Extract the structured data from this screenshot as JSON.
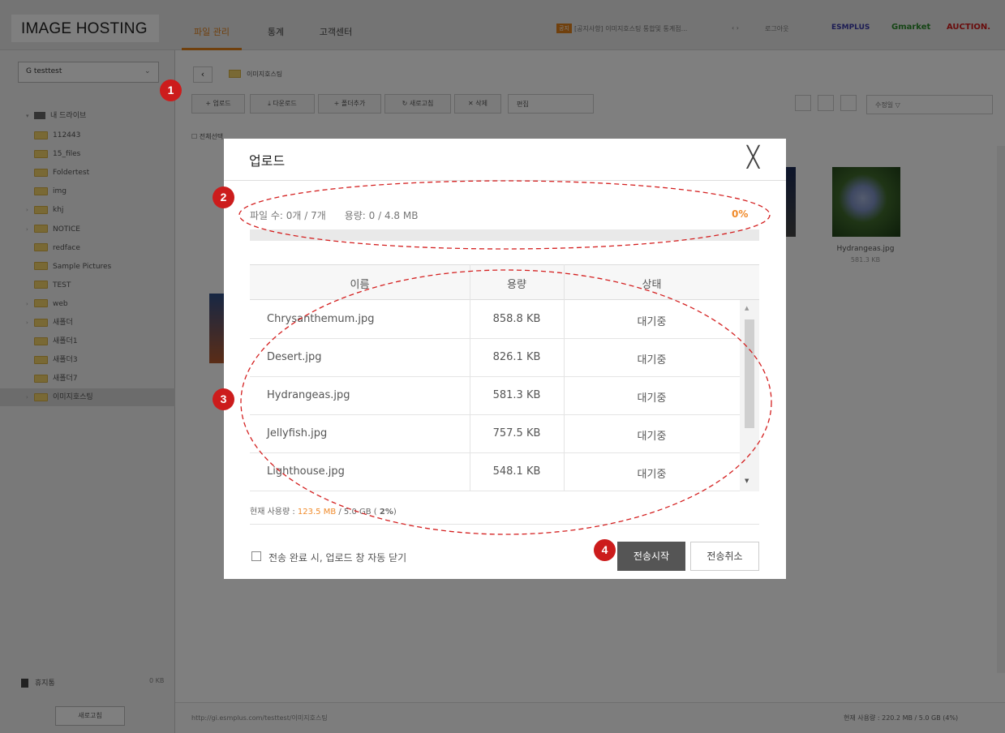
{
  "header": {
    "logo": "IMAGE HOSTING",
    "tabs": [
      "파일 관리",
      "통계",
      "고객센터"
    ],
    "notice_badge": "공지",
    "notice_text": "[공지사항] 이미지호스팅 통합및 통계점...",
    "notice_nav": "‹ ›",
    "logout": "로그아웃",
    "brands": [
      "ESMPLUS",
      "Gmarket",
      "AUCTION."
    ],
    "accent_color": "#e0801a"
  },
  "sidebar": {
    "account": "G testtest",
    "root": "내 드라이브",
    "folders": [
      "112443",
      "15_files",
      "Foldertest",
      "img",
      "khj",
      "NOTICE",
      "redface",
      "Sample Pictures",
      "TEST",
      "web",
      "새폴더",
      "새폴더1",
      "새폴더3",
      "새폴더7",
      "이미지호스팅"
    ],
    "selected_folder": "이미지호스팅",
    "trash_label": "휴지통",
    "trash_size": "0 KB",
    "refresh_label": "새로고침"
  },
  "main": {
    "path": "이미지호스팅",
    "toolbar": {
      "upload": "+ 업로드",
      "download": "⤓ 다운로드",
      "add_folder": "+ 폴더추가",
      "refresh": "↻ 새로고침",
      "delete": "✕ 삭제",
      "edit_select": "편집",
      "sort_select": "수정일 ▽"
    },
    "select_all": "전체선택",
    "thumb": {
      "name": "Hydrangeas.jpg",
      "size": "581.3 KB"
    },
    "status_url": "http://gi.esmplus.com/testtest/이미지호스팅",
    "status_usage": "현재 사용량 : 220.2 MB / 5.0 GB (4%)"
  },
  "modal": {
    "title": "업로드",
    "close_glyph": "╳",
    "file_count": "파일 수: 0개 / 7개",
    "capacity": "용량: 0 / 4.8 MB",
    "percent": "0%",
    "progress": 0,
    "columns": [
      "이름",
      "용량",
      "상태"
    ],
    "files": [
      {
        "name": "Chrysanthemum.jpg",
        "size": "858.8 KB",
        "status": "대기중"
      },
      {
        "name": "Desert.jpg",
        "size": "826.1 KB",
        "status": "대기중"
      },
      {
        "name": "Hydrangeas.jpg",
        "size": "581.3 KB",
        "status": "대기중"
      },
      {
        "name": "Jellyfish.jpg",
        "size": "757.5 KB",
        "status": "대기중"
      },
      {
        "name": "Lighthouse.jpg",
        "size": "548.1 KB",
        "status": "대기중"
      }
    ],
    "usage_prefix": "현재 사용량 : ",
    "usage_used": "123.5 MB",
    "usage_rest": " / 5.0 GB ( ",
    "usage_pct": "2%",
    "usage_end": ")",
    "auto_close": "전송 완료 시, 업로드 창 자동 닫기",
    "start_button": "전송시작",
    "cancel_button": "전송취소"
  },
  "markers": [
    "1",
    "2",
    "3",
    "4"
  ]
}
